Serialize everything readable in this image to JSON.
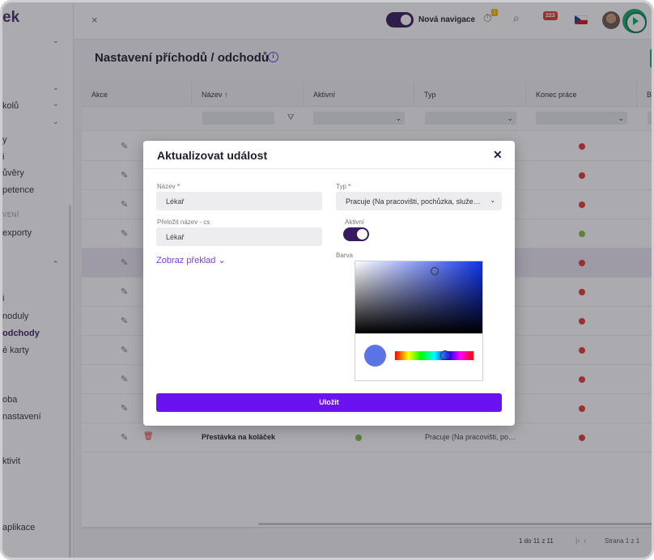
{
  "app": {
    "logo_text": "ek"
  },
  "sidebar": {
    "items": [
      {
        "label": "kolů"
      },
      {
        "label": "y"
      },
      {
        "label": "i"
      },
      {
        "label": "ůvěry"
      },
      {
        "label": "petence"
      },
      {
        "label": "VENÍ"
      },
      {
        "label": "exporty"
      },
      {
        "label": "i"
      },
      {
        "label": "noduly"
      },
      {
        "label": "odchody"
      },
      {
        "label": "é karty"
      },
      {
        "label": "oba"
      },
      {
        "label": " nastavení"
      },
      {
        "label": "ktivit"
      },
      {
        "label": "aplikace"
      }
    ]
  },
  "topbar": {
    "close_symbol": "×",
    "nav_toggle_label": "Nová navigace",
    "notif_badge": "1",
    "messages_badge": "223"
  },
  "page": {
    "title": "Nastavení příchodů / odchodů",
    "info_symbol": "i"
  },
  "table": {
    "columns": [
      "Akce",
      "Název ↑",
      "Aktivní",
      "Typ",
      "Konec práce",
      "Ba"
    ],
    "last_row": {
      "name": "Přestávka na koláček",
      "type": "Pracuje (Na pracovišti, po…"
    },
    "end_of_work_status": [
      "red",
      "red",
      "red",
      "green",
      "red",
      "red",
      "red",
      "red",
      "red",
      "red",
      "red"
    ],
    "row_active_status": [
      "green"
    ]
  },
  "pager": {
    "range_text": "1 do 11 z 11",
    "page_text": "Strana 1 z 1"
  },
  "modal": {
    "title": "Aktualizovat událost",
    "close_symbol": "✕",
    "name_label": "Název",
    "name_value": "Lékař",
    "type_label": "Typ",
    "type_value": "Pracuje (Na pracovišti, pochůzka, služe…",
    "translate_label": "Přeložit název - cs",
    "translate_value": "Lékař",
    "active_label": "Aktivní",
    "active_value": true,
    "show_translation_label": "Zobraz překlad",
    "color_label": "Barva",
    "color_value": "#5a73e6",
    "save_label": "Uložit",
    "required_marker": "*"
  },
  "colors": {
    "primary": "#6a12f0",
    "dark_accent": "#3a1a5e",
    "status_red": "#e53935",
    "status_green": "#7cc242"
  }
}
